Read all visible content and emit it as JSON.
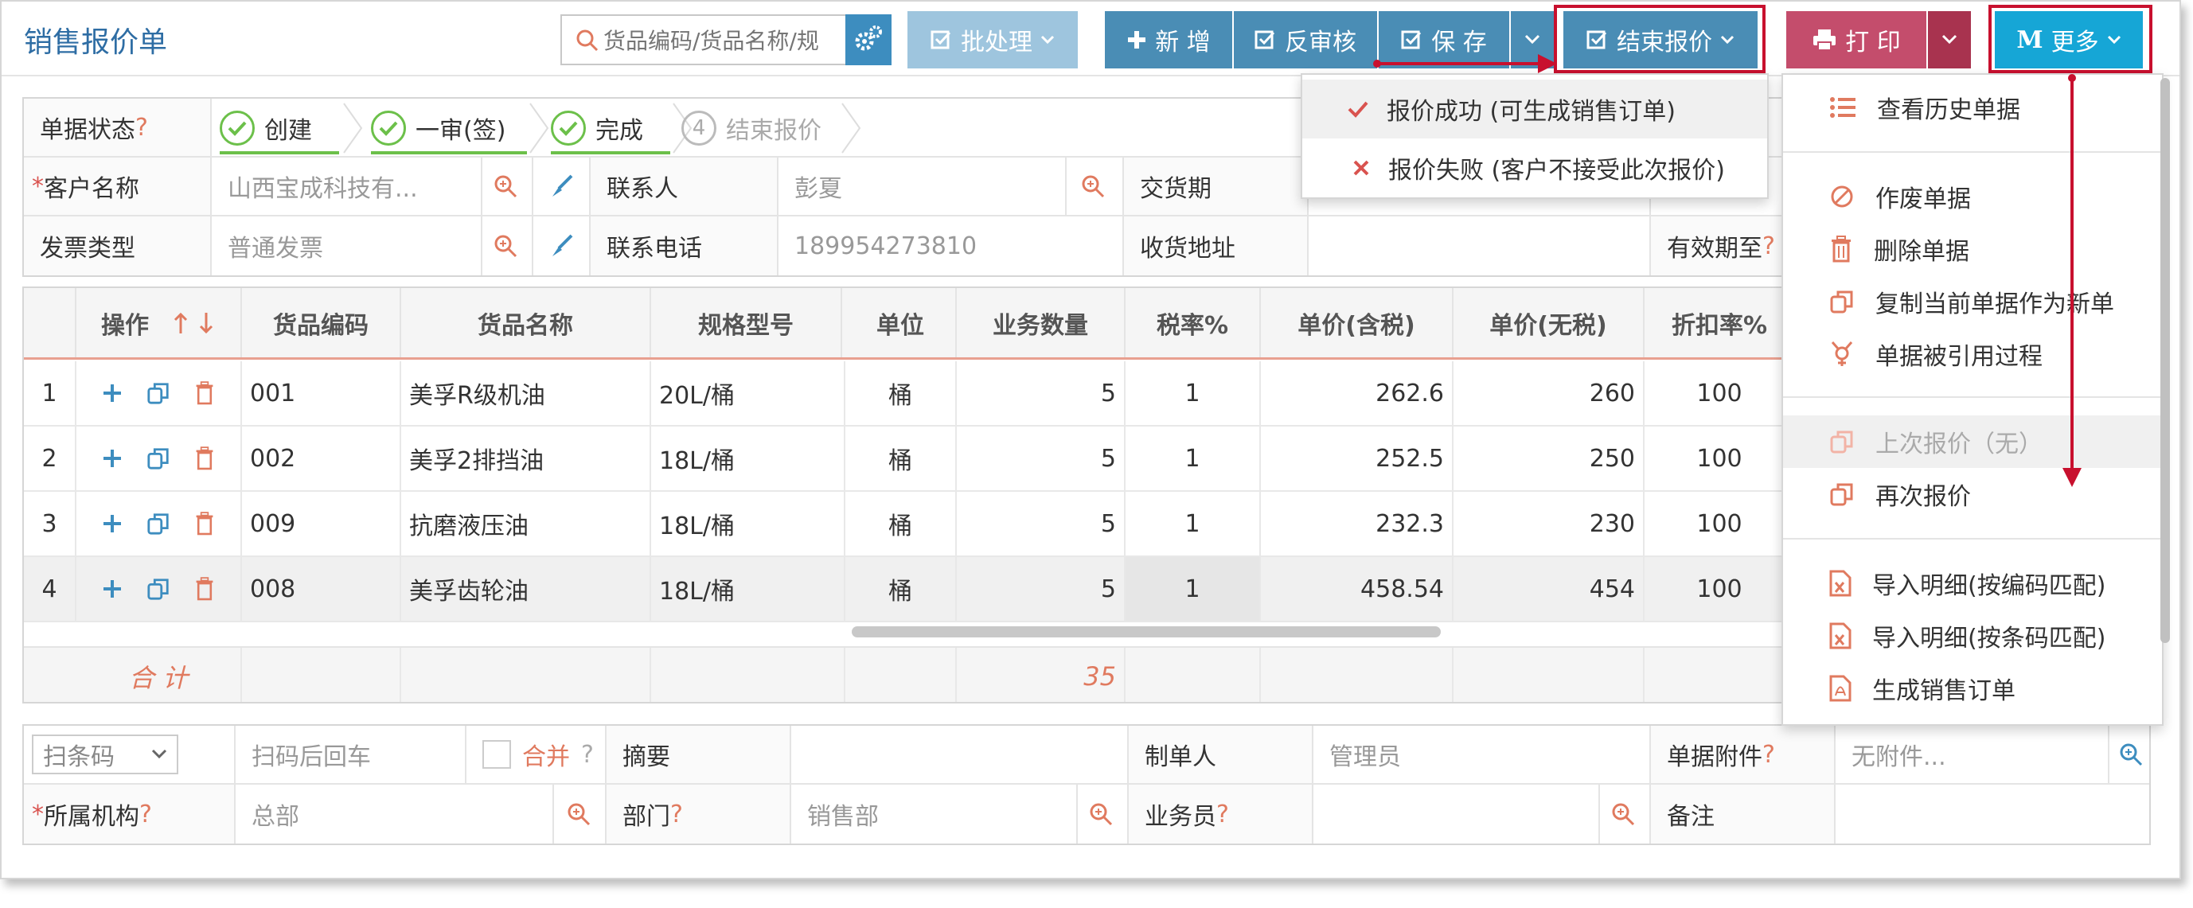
{
  "header": {
    "title": "销售报价单",
    "search_placeholder": "货品编码/货品名称/规",
    "batch_label": "批处理",
    "new_label": "新 增",
    "reverse_label": "反审核",
    "save_label": "保 存",
    "end_label": "结束报价",
    "print_label": "打 印",
    "more_label": "更多",
    "more_letter": "M"
  },
  "status": {
    "label": "单据状态",
    "q": "?",
    "steps": [
      {
        "label": "创建",
        "state": "done"
      },
      {
        "label": "一审(签)",
        "state": "done"
      },
      {
        "label": "完成",
        "state": "done"
      },
      {
        "label": "结束报价",
        "state": "todo",
        "num": "4"
      }
    ]
  },
  "form": {
    "customer_label": "客户名称",
    "customer_value": "山西宝成科技有...",
    "contact_label": "联系人",
    "contact_value": "彭夏",
    "delivery_label": "交货期",
    "invoice_label": "发票类型",
    "invoice_value": "普通发票",
    "phone_label": "联系电话",
    "phone_value": "189954273810",
    "address_label": "收货地址",
    "valid_label": "有效期至",
    "asterisk": "*"
  },
  "grid": {
    "headers": [
      "操作",
      "货品编码",
      "货品名称",
      "规格型号",
      "单位",
      "业务数量",
      "税率%",
      "单价(含税)",
      "单价(无税)",
      "折扣率%"
    ],
    "rows": [
      {
        "no": "1",
        "code": "001",
        "name": "美孚R级机油",
        "spec": "20L/桶",
        "unit": "桶",
        "qty": "5",
        "tax": "1",
        "price_tax": "262.6",
        "price": "260",
        "discount": "100"
      },
      {
        "no": "2",
        "code": "002",
        "name": "美孚2排挡油",
        "spec": "18L/桶",
        "unit": "桶",
        "qty": "5",
        "tax": "1",
        "price_tax": "252.5",
        "price": "250",
        "discount": "100"
      },
      {
        "no": "3",
        "code": "009",
        "name": "抗磨液压油",
        "spec": "18L/桶",
        "unit": "桶",
        "qty": "5",
        "tax": "1",
        "price_tax": "232.3",
        "price": "230",
        "discount": "100"
      },
      {
        "no": "4",
        "code": "008",
        "name": "美孚齿轮油",
        "spec": "18L/桶",
        "unit": "桶",
        "qty": "5",
        "tax": "1",
        "price_tax": "458.54",
        "price": "454",
        "discount": "100"
      }
    ],
    "total_label": "合 计",
    "total_qty": "35"
  },
  "bottom": {
    "scan_select": "扫条码",
    "scan_placeholder": "扫码后回车",
    "merge_label": "合并",
    "summary_label": "摘要",
    "maker_label": "制单人",
    "maker_value": "管理员",
    "attach_label": "单据附件",
    "attach_value": "无附件...",
    "org_label": "所属机构",
    "org_value": "总部",
    "dept_label": "部门",
    "dept_value": "销售部",
    "sales_label": "业务员",
    "remark_label": "备注",
    "q": "?",
    "asterisk": "*"
  },
  "end_menu": {
    "items": [
      {
        "label": "报价成功 (可生成销售订单)",
        "icon": "check-icon"
      },
      {
        "label": "报价失败 (客户不接受此次报价)",
        "icon": "cross-icon"
      }
    ]
  },
  "more_menu": {
    "items": [
      {
        "label": "查看历史单据",
        "icon": "list-icon"
      },
      {
        "label": "作废单据",
        "icon": "ban-icon"
      },
      {
        "label": "删除单据",
        "icon": "trash-icon"
      },
      {
        "label": "复制当前单据作为新单",
        "icon": "copy-icon"
      },
      {
        "label": "单据被引用过程",
        "icon": "link-icon"
      },
      {
        "label": "上次报价（无）",
        "icon": "copy-icon"
      },
      {
        "label": "再次报价",
        "icon": "copy-icon"
      },
      {
        "label": "导入明细(按编码匹配)",
        "icon": "excel-icon"
      },
      {
        "label": "导入明细(按条码匹配)",
        "icon": "excel-icon"
      },
      {
        "label": "生成销售订单",
        "icon": "pdf-icon"
      }
    ]
  },
  "colors": {
    "primary": "#4a8db5",
    "highlight": "#c8102e",
    "more": "#16a6d6",
    "print": "#c44d6c",
    "success": "#6cc04a"
  }
}
